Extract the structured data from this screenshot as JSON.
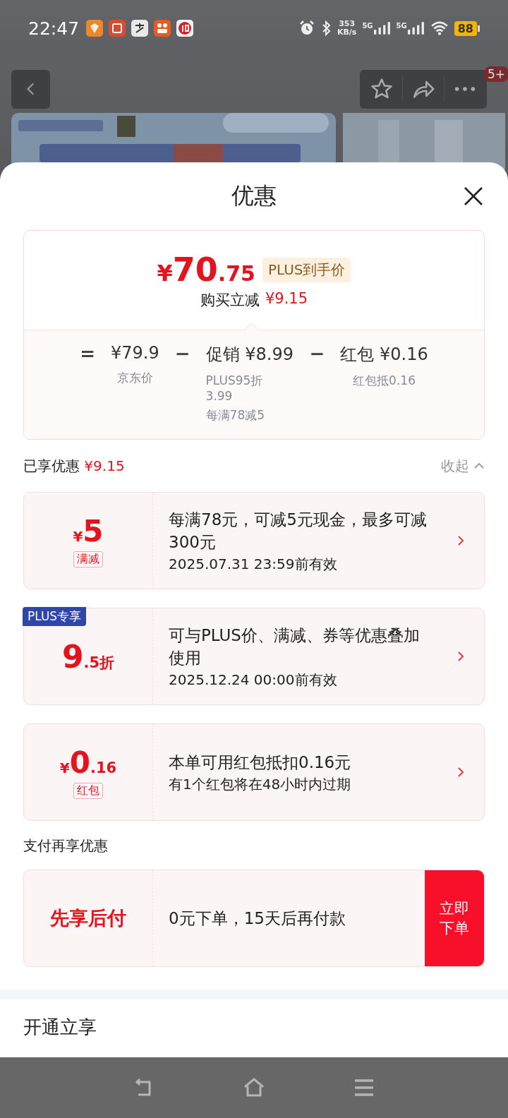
{
  "status_bar": {
    "time": "22:47",
    "net_speed": "353",
    "net_unit": "KB/s",
    "sim1": "5G",
    "sim2": "5G",
    "battery": "88"
  },
  "header": {
    "badge": "5+"
  },
  "sheet": {
    "title": "优惠"
  },
  "summary": {
    "price_symbol": "¥",
    "price_int": "70",
    "price_dec": ".75",
    "price_tag": "PLUS到手价",
    "saving_label": "购买立减",
    "saving": "¥9.15",
    "formula": [
      {
        "op": "=",
        "amount": "¥79.9",
        "notes": [
          "京东价"
        ]
      },
      {
        "op": "−",
        "label": "促销",
        "amount": "¥8.99",
        "notes": [
          "PLUS95折 3.99",
          "每满78减5"
        ]
      },
      {
        "op": "−",
        "label": "红包",
        "amount": "¥0.16",
        "notes": [
          "红包抵0.16"
        ]
      }
    ]
  },
  "enjoyed": {
    "label": "已享优惠",
    "amount": "¥9.15",
    "toggle": "收起",
    "expanded": true
  },
  "coupons": [
    {
      "kind": "cash",
      "symbol": "¥",
      "big": "5",
      "tag": "满减",
      "text": "每满78元，可减5元现金，最多可减300元",
      "sub": "2025.07.31 23:59前有效"
    },
    {
      "kind": "discount",
      "corner": "PLUS专享",
      "big": "9",
      "small": ".5折",
      "text": "可与PLUS价、满减、券等优惠叠加使用",
      "sub": "2025.12.24 00:00前有效"
    },
    {
      "kind": "cash",
      "symbol": "¥",
      "big": "0",
      "small": ".16",
      "tag": "红包",
      "text": "本单可用红包抵扣0.16元",
      "sub": "有1个红包将在48小时内过期"
    }
  ],
  "pay": {
    "title": "支付再享优惠",
    "name": "先享后付",
    "text": "0元下单，15天后再付款",
    "button": "立即下单"
  },
  "next_section": {
    "title": "开通立享"
  }
}
